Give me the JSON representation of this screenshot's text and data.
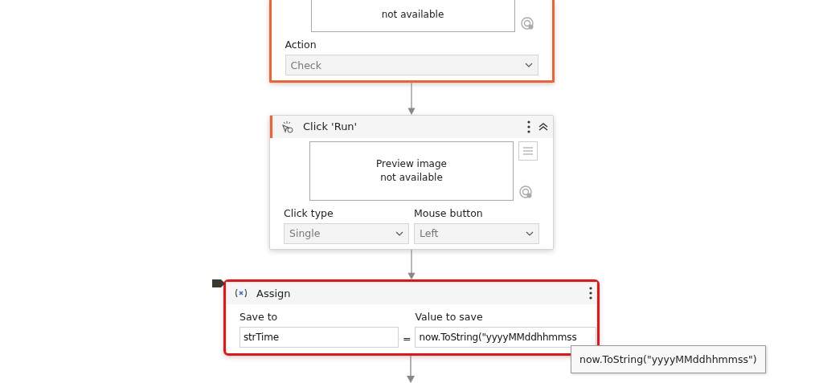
{
  "activities": [
    {
      "kind": "partial",
      "selected": true,
      "preview": "not available",
      "fields": [
        {
          "label": "Action",
          "value": "Check"
        }
      ]
    },
    {
      "kind": "click",
      "selected": true,
      "title": "Click 'Run'",
      "collapsed": false,
      "preview": "Preview image\nnot available",
      "fields": [
        {
          "label": "Click type",
          "value": "Single"
        },
        {
          "label": "Mouse button",
          "value": "Left"
        }
      ]
    },
    {
      "kind": "assign",
      "selected": true,
      "title": "Assign",
      "save_to_label": "Save to",
      "save_to": "strTime",
      "operator": "=",
      "value_label": "Value to save",
      "value": "now.ToString(\"yyyyMMddhhmmss",
      "tooltip": "now.ToString(\"yyyyMMddhhmmss\")"
    }
  ]
}
